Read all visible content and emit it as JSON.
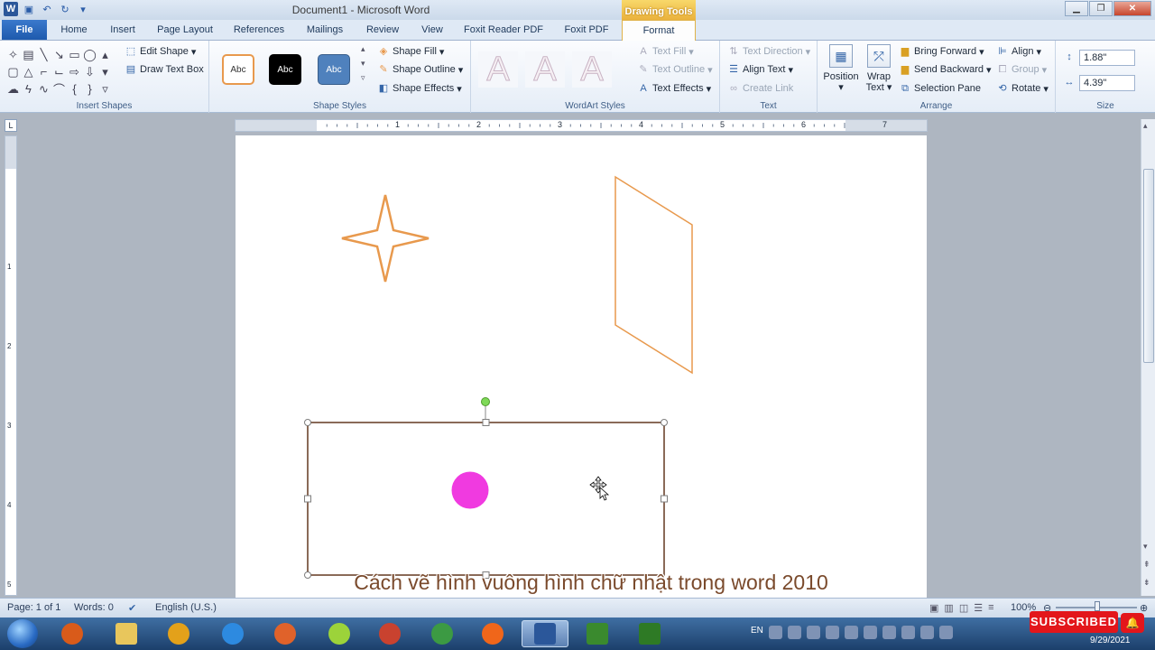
{
  "window": {
    "title": "Document1 - Microsoft Word",
    "contextual_tab": "Drawing Tools",
    "controls": {
      "minimize": "▁",
      "maximize": "❐",
      "close": "✕"
    }
  },
  "tabs": {
    "file": "File",
    "items": [
      "Home",
      "Insert",
      "Page Layout",
      "References",
      "Mailings",
      "Review",
      "View",
      "Foxit Reader PDF",
      "Foxit PDF"
    ],
    "format": "Format"
  },
  "ribbon": {
    "insert_shapes": {
      "label": "Insert Shapes",
      "edit_shape": "Edit Shape",
      "draw_text_box": "Draw Text Box"
    },
    "shape_styles": {
      "label": "Shape Styles",
      "sample": "Abc",
      "shape_fill": "Shape Fill",
      "shape_outline": "Shape Outline",
      "shape_effects": "Shape Effects"
    },
    "wordart_styles": {
      "label": "WordArt Styles",
      "sample": "A",
      "text_fill": "Text Fill",
      "text_outline": "Text Outline",
      "text_effects": "Text Effects"
    },
    "text": {
      "label": "Text",
      "text_direction": "Text Direction",
      "align_text": "Align Text",
      "create_link": "Create Link"
    },
    "arrange": {
      "label": "Arrange",
      "position": "Position",
      "wrap_text_1": "Wrap",
      "wrap_text_2": "Text",
      "bring_forward": "Bring Forward",
      "send_backward": "Send Backward",
      "selection_pane": "Selection Pane",
      "align": "Align",
      "group": "Group",
      "rotate": "Rotate"
    },
    "size": {
      "label": "Size",
      "height": "1.88\"",
      "width": "4.39\""
    }
  },
  "ruler": {
    "numbers": [
      "1",
      "2",
      "3",
      "4",
      "5",
      "6",
      "7"
    ],
    "vnumbers": [
      "1",
      "2",
      "3",
      "4",
      "5"
    ]
  },
  "document": {
    "caption": "Cách vẽ hình vuông hình chữ nhật trong word 2010",
    "colors": {
      "outline": "#e8994d",
      "circle_fill": "#f03ae0",
      "selection_border": "#8a6a58",
      "rotate_handle": "#7ed957"
    }
  },
  "status": {
    "page": "Page: 1 of 1",
    "words": "Words: 0",
    "language": "English (U.S.)",
    "zoom": "100%"
  },
  "taskbar": {
    "language": "EN",
    "date": "9/29/2021",
    "subscribed": "SUBSCRIBED",
    "apps": [
      "media-player",
      "file-explorer",
      "chrome",
      "internet-explorer",
      "basketball-app",
      "unikey",
      "chrome",
      "chrome",
      "firefox",
      "word",
      "camtasia",
      "camtasia"
    ],
    "app_colors": [
      "#d95b1a",
      "#e8c65c",
      "#e3a11a",
      "#2d8ae0",
      "#e0622a",
      "#9cd33a",
      "#c9422f",
      "#3c9a43",
      "#f0661a",
      "#2b579a",
      "#3a8a2e",
      "#2e7a25"
    ]
  }
}
